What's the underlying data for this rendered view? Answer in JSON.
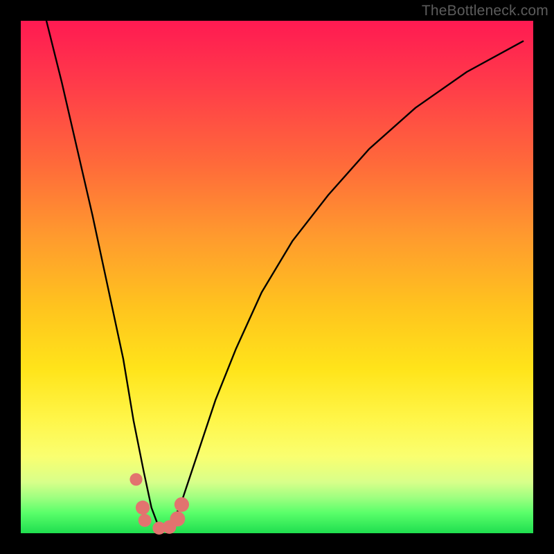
{
  "watermark": "TheBottleneck.com",
  "colors": {
    "frame": "#000000",
    "gradient_stops": [
      "#ff1a52",
      "#ff3a4a",
      "#ff6a3a",
      "#ff9a2e",
      "#ffc41e",
      "#ffe41a",
      "#fff64a",
      "#faff70",
      "#d8ff8a",
      "#9fff80",
      "#5aff6a",
      "#1fde4f"
    ],
    "curve": "#000000",
    "marker_fill": "#e2736f",
    "marker_stroke": "#d85a55"
  },
  "chart_data": {
    "type": "line",
    "title": "",
    "xlabel": "",
    "ylabel": "",
    "xlim": [
      0,
      100
    ],
    "ylim": [
      0,
      100
    ],
    "note": "Axes are unlabeled; values are estimated in percent of plot area width/height. y=0 at bottom (green), y=100 at top (red). Curve is a V shape with minimum near x≈27.",
    "series": [
      {
        "name": "bottleneck-curve",
        "x": [
          5,
          8,
          11,
          14,
          17,
          20,
          22,
          24,
          25.5,
          27,
          29,
          31,
          33,
          35,
          38,
          42,
          47,
          53,
          60,
          68,
          77,
          87,
          98
        ],
        "y": [
          100,
          88,
          75,
          62,
          48,
          34,
          22,
          12,
          5,
          1,
          1.5,
          5,
          11,
          17,
          26,
          36,
          47,
          57,
          66,
          75,
          83,
          90,
          96
        ]
      }
    ],
    "markers": [
      {
        "x": 22.5,
        "y": 10.5,
        "r": 1.1
      },
      {
        "x": 23.8,
        "y": 5.0,
        "r": 1.4
      },
      {
        "x": 24.2,
        "y": 2.5,
        "r": 1.2
      },
      {
        "x": 27.0,
        "y": 1.0,
        "r": 1.2
      },
      {
        "x": 29.0,
        "y": 1.2,
        "r": 1.3
      },
      {
        "x": 30.6,
        "y": 2.8,
        "r": 1.6
      },
      {
        "x": 31.4,
        "y": 5.6,
        "r": 1.5
      }
    ]
  }
}
